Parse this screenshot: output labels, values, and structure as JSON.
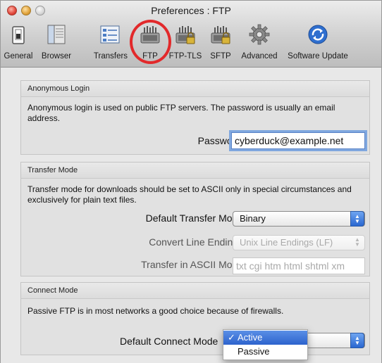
{
  "window": {
    "title": "Preferences : FTP"
  },
  "toolbar": {
    "items": [
      {
        "label": "General",
        "icon": "general-switch-icon"
      },
      {
        "label": "Browser",
        "icon": "browser-window-icon"
      },
      {
        "label": "Transfers",
        "icon": "transfers-list-icon"
      },
      {
        "label": "FTP",
        "icon": "ftp-network-icon"
      },
      {
        "label": "FTP-TLS",
        "icon": "ftp-tls-lock-icon"
      },
      {
        "label": "SFTP",
        "icon": "sftp-lock-icon"
      },
      {
        "label": "Advanced",
        "icon": "gear-icon"
      },
      {
        "label": "Software Update",
        "icon": "software-update-icon"
      }
    ],
    "selected": "FTP",
    "highlight_color": "#e2292b"
  },
  "anonymous_login": {
    "header": "Anonymous Login",
    "description": "Anonymous login is used on public FTP servers. The password is usually an email address.",
    "password_label": "Password:",
    "password_value": "cyberduck@example.net"
  },
  "transfer_mode": {
    "header": "Transfer Mode",
    "description": "Transfer mode for downloads should be set to ASCII only in special circumstances and exclusively for plain text files.",
    "default_mode_label": "Default Transfer Mode:",
    "default_mode_value": "Binary",
    "line_endings_label": "Convert Line Endings:",
    "line_endings_value": "Unix Line Endings (LF)",
    "ascii_label": "Transfer in ASCII Mode:",
    "ascii_value": "txt cgi htm html shtml xm"
  },
  "connect_mode": {
    "header": "Connect Mode",
    "description": "Passive FTP is in most networks a good choice because of firewalls.",
    "default_label": "Default Connect Mode",
    "options": [
      "Active",
      "Passive"
    ],
    "selected": "Active",
    "check": "✓"
  },
  "colors": {
    "accent": "#2d63cd",
    "focus_ring": "#7fa7df"
  }
}
